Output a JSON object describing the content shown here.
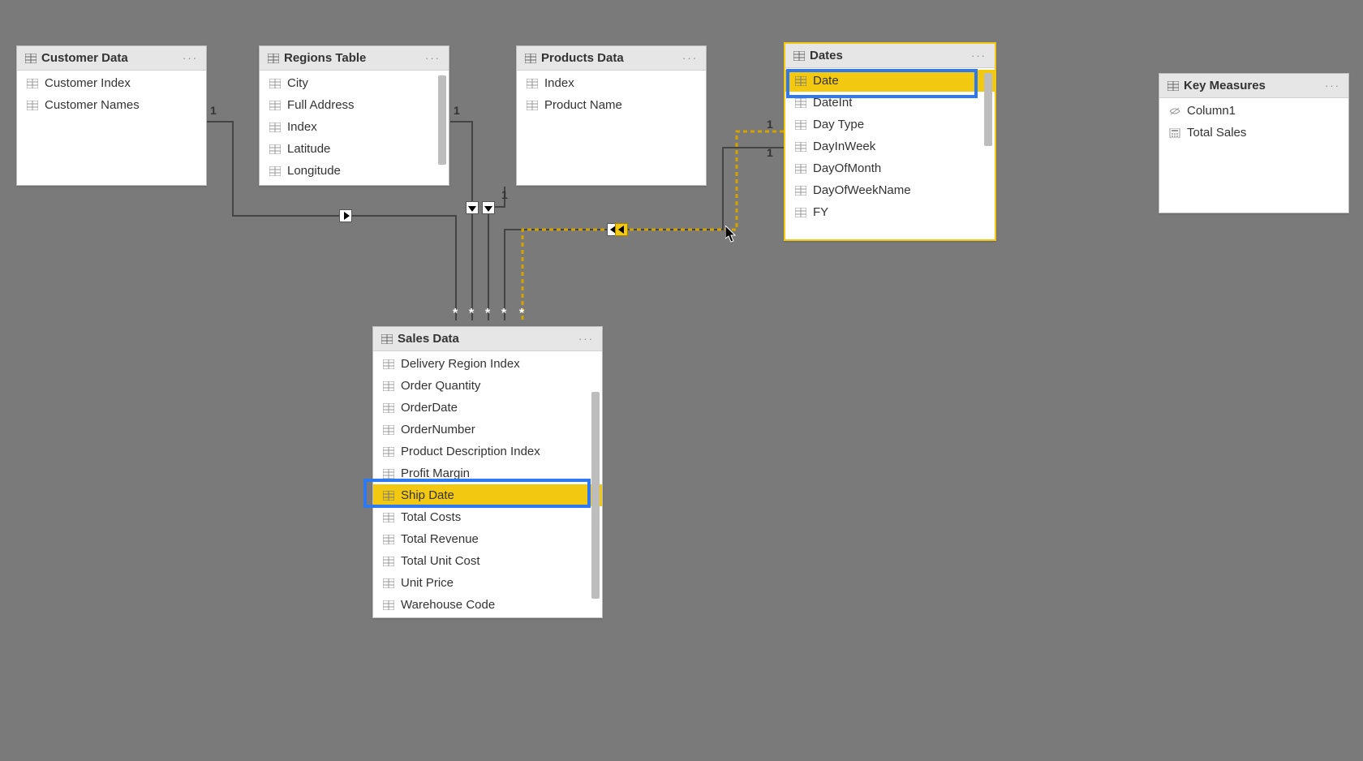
{
  "tables": {
    "customer": {
      "title": "Customer Data",
      "fields": [
        "Customer Index",
        "Customer Names"
      ]
    },
    "regions": {
      "title": "Regions Table",
      "fields": [
        "City",
        "Full Address",
        "Index",
        "Latitude",
        "Longitude"
      ]
    },
    "products": {
      "title": "Products Data",
      "fields": [
        "Index",
        "Product Name"
      ]
    },
    "dates": {
      "title": "Dates",
      "fields": [
        "Date",
        "DateInt",
        "Day Type",
        "DayInWeek",
        "DayOfMonth",
        "DayOfWeekName",
        "FY"
      ],
      "highlight_index": 0
    },
    "measures": {
      "title": "Key Measures",
      "fields": [
        "Column1",
        "Total Sales"
      ]
    },
    "sales": {
      "title": "Sales Data",
      "fields": [
        "Delivery Region Index",
        "Order Quantity",
        "OrderDate",
        "OrderNumber",
        "Product Description Index",
        "Profit Margin",
        "Ship Date",
        "Total Costs",
        "Total Revenue",
        "Total Unit Cost",
        "Unit Price",
        "Warehouse Code"
      ],
      "highlight_index": 6
    }
  },
  "relationships": {
    "cardinality_one": "1",
    "cardinality_many": "*"
  },
  "menu_label": "···"
}
